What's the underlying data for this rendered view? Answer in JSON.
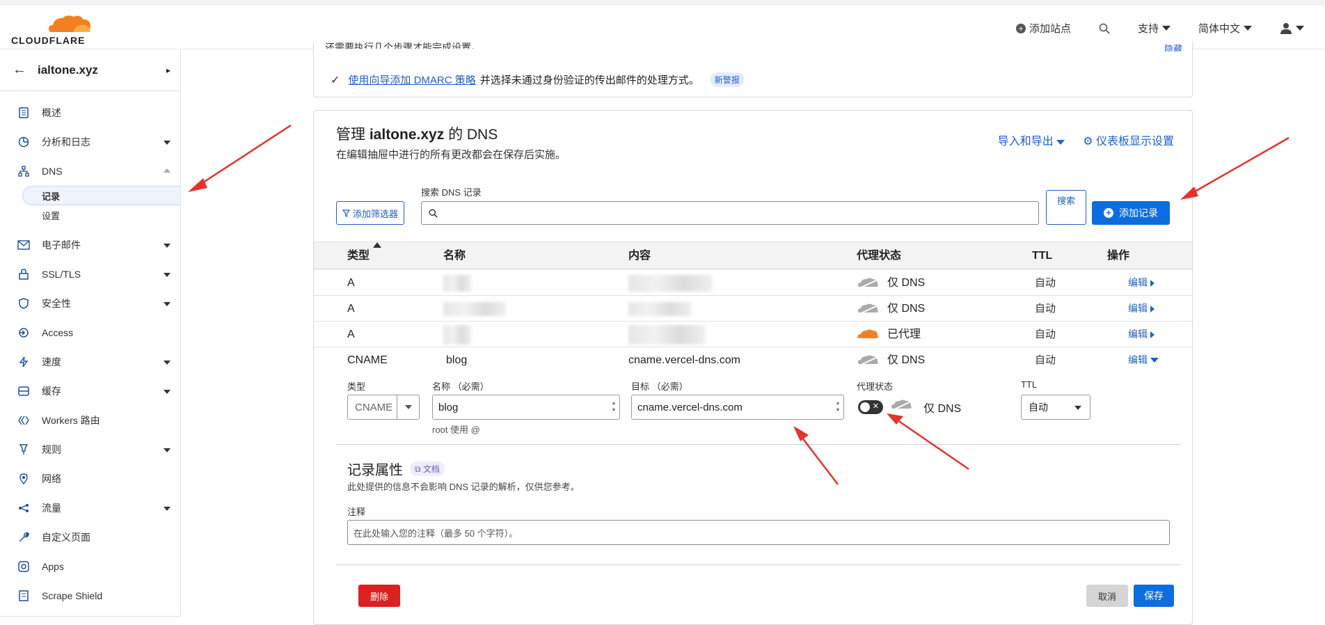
{
  "brand": {
    "name": "CLOUDFLARE",
    "accent": "#f38020",
    "link": "#2160c4",
    "primary": "#0d6de0",
    "danger": "#e02020"
  },
  "topnav": {
    "add_site": "添加站点",
    "support": "支持",
    "language": "简体中文"
  },
  "sidebar": {
    "zone": "ialtone.xyz",
    "items": [
      {
        "label": "概述",
        "icon": "document-icon"
      },
      {
        "label": "分析和日志",
        "icon": "chart-icon"
      },
      {
        "label": "DNS",
        "icon": "network-icon"
      },
      {
        "label": "电子邮件",
        "icon": "email-icon"
      },
      {
        "label": "SSL/TLS",
        "icon": "lock-icon"
      },
      {
        "label": "安全性",
        "icon": "shield-icon"
      },
      {
        "label": "Access",
        "icon": "access-icon"
      },
      {
        "label": "速度",
        "icon": "bolt-icon"
      },
      {
        "label": "缓存",
        "icon": "cache-icon"
      },
      {
        "label": "Workers 路由",
        "icon": "workers-icon"
      },
      {
        "label": "规则",
        "icon": "rules-icon"
      },
      {
        "label": "网络",
        "icon": "pin-icon"
      },
      {
        "label": "流量",
        "icon": "traffic-icon"
      },
      {
        "label": "自定义页面",
        "icon": "wrench-icon"
      },
      {
        "label": "Apps",
        "icon": "apps-icon"
      },
      {
        "label": "Scrape Shield",
        "icon": "scrape-icon"
      }
    ],
    "dns_sub": {
      "records": "记录",
      "settings": "设置"
    }
  },
  "notice": {
    "cut_text": "还需要执行几个步骤才能完成设置。",
    "hide_link": "隐藏",
    "link": "使用向导添加 DMARC 策略",
    "rest": "并选择未通过身份验证的传出邮件的处理方式。",
    "badge": "新警报"
  },
  "dns": {
    "title_prefix": "管理",
    "zone": "ialtone.xyz",
    "title_suffix": "的 DNS",
    "subtitle": "在编辑抽屉中进行的所有更改都会在保存后实施。",
    "import_export": "导入和导出",
    "dashboard_settings": "仪表板显示设置",
    "filter_button": "添加筛选器",
    "search_label": "搜索 DNS 记录",
    "search_button": "搜索",
    "add_record": "添加记录",
    "columns": {
      "type": "类型",
      "name": "名称",
      "content": "内容",
      "proxy": "代理状态",
      "ttl": "TTL",
      "actions": "操作"
    },
    "rows": [
      {
        "type": "A",
        "name": "",
        "content": "",
        "proxy": "仅 DNS",
        "proxied": false,
        "ttl": "自动",
        "action": "编辑"
      },
      {
        "type": "A",
        "name": "",
        "content": "",
        "proxy": "仅 DNS",
        "proxied": false,
        "ttl": "自动",
        "action": "编辑"
      },
      {
        "type": "A",
        "name": "",
        "content": "",
        "proxy": "已代理",
        "proxied": true,
        "ttl": "自动",
        "action": "编辑"
      },
      {
        "type": "CNAME",
        "name": "blog",
        "content": "cname.vercel-dns.com",
        "proxy": "仅 DNS",
        "proxied": false,
        "ttl": "自动",
        "action": "编辑"
      }
    ]
  },
  "edit": {
    "type_label": "类型",
    "type_value": "CNAME",
    "name_label": "名称 （必需）",
    "name_value": "blog",
    "name_hint": "root 使用 @",
    "target_label": "目标 （必需）",
    "target_value": "cname.vercel-dns.com",
    "proxy_label": "代理状态",
    "proxy_value": "仅 DNS",
    "ttl_label": "TTL",
    "ttl_value": "自动",
    "attrs_title": "记录属性",
    "doc_badge": "文档",
    "attrs_sub": "此处提供的信息不会影响 DNS 记录的解析，仅供您参考。",
    "note_label": "注释",
    "note_placeholder": "在此处输入您的注释（最多 50 个字符）。",
    "delete": "删除",
    "cancel": "取消",
    "save": "保存"
  }
}
